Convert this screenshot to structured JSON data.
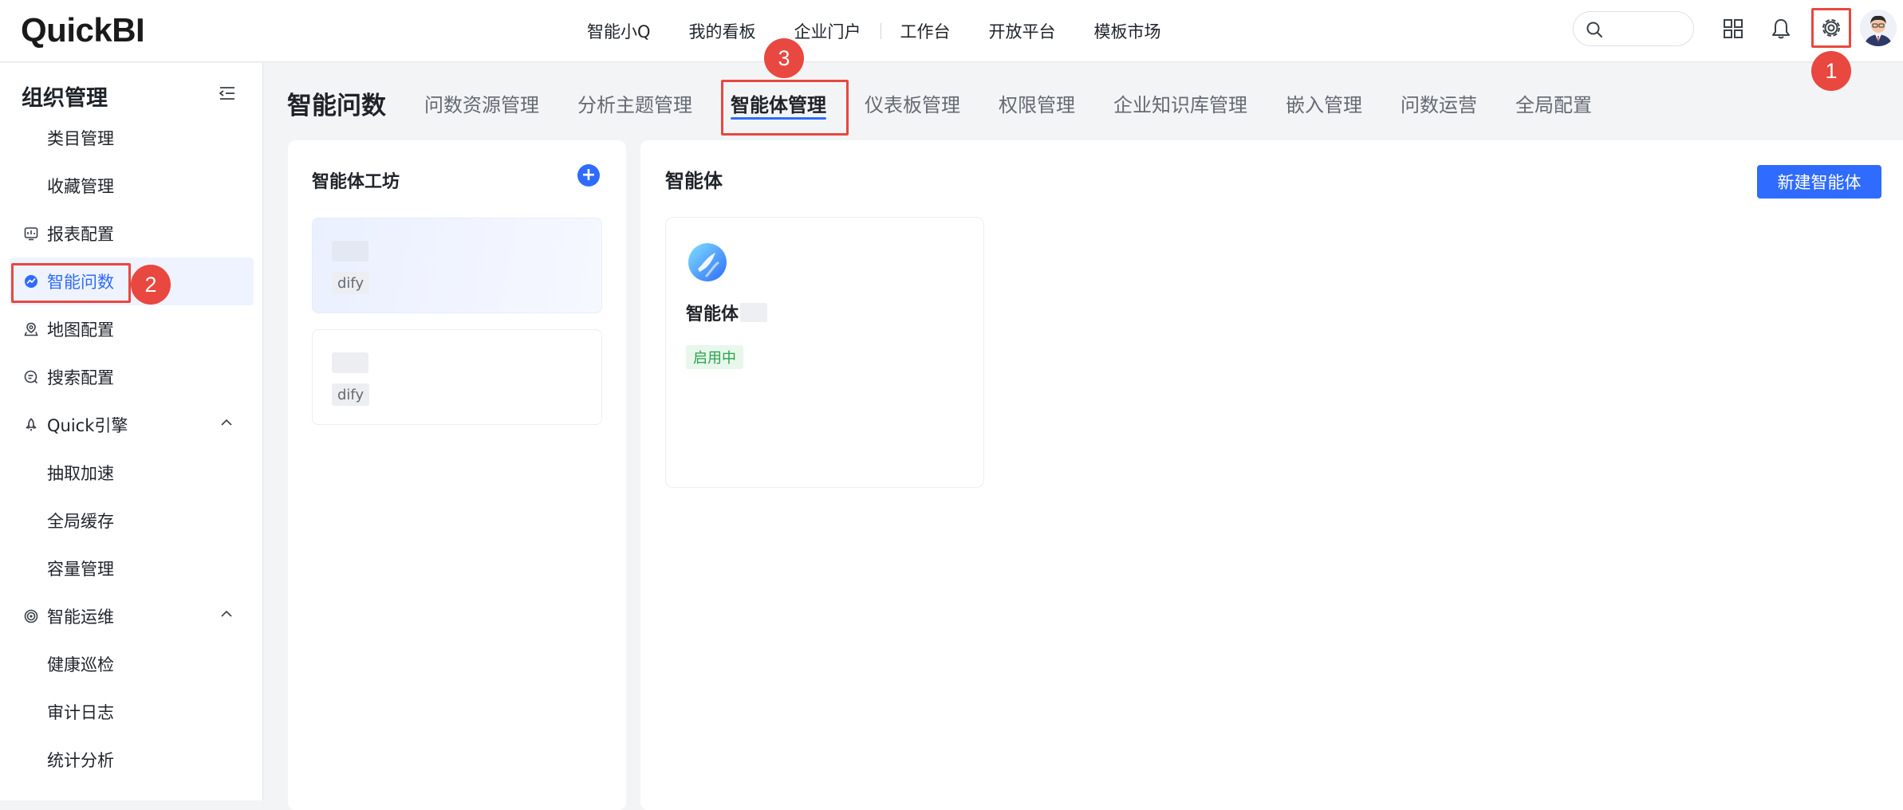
{
  "app": {
    "logo_text_a": "Quick",
    "logo_text_b": " BI"
  },
  "topnav": {
    "items": [
      "智能小Q",
      "我的看板",
      "企业门户",
      "工作台",
      "开放平台",
      "模板市场"
    ]
  },
  "header_icons": [
    "search-icon",
    "apps-grid-icon",
    "bell-icon",
    "gear-icon",
    "avatar"
  ],
  "steps": {
    "one": "1",
    "two": "2",
    "three": "3"
  },
  "sidebar": {
    "title": "组织管理",
    "items": [
      {
        "label": "类目管理",
        "type": "child"
      },
      {
        "label": "收藏管理",
        "type": "child"
      },
      {
        "label": "报表配置",
        "type": "group",
        "icon": "report-icon"
      },
      {
        "label": "智能问数",
        "type": "group",
        "icon": "smart-query-icon",
        "active": true
      },
      {
        "label": "地图配置",
        "type": "group",
        "icon": "map-pin-icon"
      },
      {
        "label": "搜索配置",
        "type": "group",
        "icon": "search-config-icon"
      },
      {
        "label": "Quick引擎",
        "type": "group",
        "icon": "rocket-icon",
        "expanded": true
      },
      {
        "label": "抽取加速",
        "type": "child"
      },
      {
        "label": "全局缓存",
        "type": "child"
      },
      {
        "label": "容量管理",
        "type": "child"
      },
      {
        "label": "智能运维",
        "type": "group",
        "icon": "target-icon",
        "expanded": true
      },
      {
        "label": "健康巡检",
        "type": "child"
      },
      {
        "label": "审计日志",
        "type": "child"
      },
      {
        "label": "统计分析",
        "type": "child"
      }
    ]
  },
  "main": {
    "title": "智能问数",
    "tabs": [
      "问数资源管理",
      "分析主题管理",
      "智能体管理",
      "仪表板管理",
      "权限管理",
      "企业知识库管理",
      "嵌入管理",
      "问数运营",
      "全局配置"
    ],
    "active_tab": "智能体管理"
  },
  "workshop": {
    "title": "智能体工坊",
    "add_label": "+",
    "cards": [
      {
        "tag": "dify",
        "selected": true
      },
      {
        "tag": "dify",
        "selected": false
      }
    ]
  },
  "agents": {
    "title": "智能体",
    "new_button": "新建智能体",
    "cards": [
      {
        "name": "智能体",
        "status": "启用中"
      }
    ]
  },
  "colors": {
    "accent": "#2f6bff",
    "highlight": "#e8483f",
    "status_green": "#2ba24c"
  }
}
